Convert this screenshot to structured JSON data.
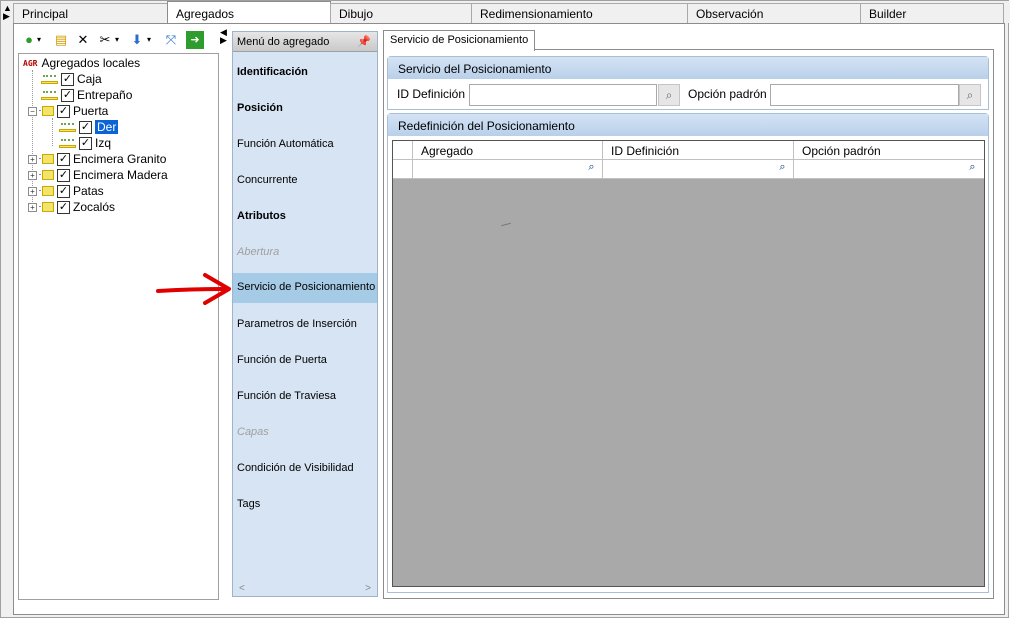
{
  "top_tabs": [
    {
      "label": "Principal",
      "active": false
    },
    {
      "label": "Agregados",
      "active": true
    },
    {
      "label": "Dibujo",
      "active": false
    },
    {
      "label": "Redimensionamiento",
      "active": false
    },
    {
      "label": "Observación",
      "active": false
    },
    {
      "label": "Builder",
      "active": false
    }
  ],
  "toolbar": {
    "icons": [
      "back-icon",
      "new-icon",
      "delete-icon",
      "cut-icon",
      "move-down-icon",
      "connect-icon",
      "export-icon"
    ]
  },
  "tree": {
    "root_badge": "AGR",
    "root_label": "Agregados locales",
    "items": [
      {
        "label": "Caja",
        "checked": true,
        "type": "item"
      },
      {
        "label": "Entrepaño",
        "checked": true,
        "type": "item"
      },
      {
        "label": "Puerta",
        "checked": true,
        "type": "folder",
        "expanded": true
      },
      {
        "label": "Der",
        "checked": true,
        "type": "item",
        "selected": true
      },
      {
        "label": "Izq",
        "checked": true,
        "type": "item"
      },
      {
        "label": "Encimera Granito",
        "checked": true,
        "type": "folder"
      },
      {
        "label": "Encimera Madera",
        "checked": true,
        "type": "folder"
      },
      {
        "label": "Patas",
        "checked": true,
        "type": "folder"
      },
      {
        "label": "Zocalós",
        "checked": true,
        "type": "folder"
      }
    ]
  },
  "menu": {
    "title": "Menú do agregado",
    "items": [
      {
        "label": "Identificación",
        "style": "bold"
      },
      {
        "label": "Posición",
        "style": "bold"
      },
      {
        "label": "Función Automática",
        "style": "normal"
      },
      {
        "label": "Concurrente",
        "style": "normal"
      },
      {
        "label": "Atributos",
        "style": "bold"
      },
      {
        "label": "Abertura",
        "style": "disabled"
      },
      {
        "label": "Servicio de Posicionamiento",
        "style": "active"
      },
      {
        "label": "Parametros de Inserción",
        "style": "normal"
      },
      {
        "label": "Función de Puerta",
        "style": "normal"
      },
      {
        "label": "Función de Traviesa",
        "style": "normal"
      },
      {
        "label": "Capas",
        "style": "disabled"
      },
      {
        "label": "Condición de Visibilidad",
        "style": "normal"
      },
      {
        "label": "Tags",
        "style": "normal"
      }
    ],
    "scroll_left": "<",
    "scroll_right": ">"
  },
  "detail": {
    "tab_label": "Servicio de Posicionamiento",
    "group1": {
      "title": "Servicio del Posicionamiento",
      "id_label": "ID Definición",
      "id_value": "",
      "option_label": "Opción padrón",
      "option_value": ""
    },
    "group2": {
      "title": "Redefinición del Posicionamiento",
      "columns": [
        "Agregado",
        "ID Definición",
        "Opción padrón"
      ]
    }
  },
  "colors": {
    "menu_bg": "#d6e4f3",
    "menu_active": "#a6cbe6",
    "group_header": "#c5d9ef",
    "arrow": "#e00000",
    "grid_bg": "#a9a9a9",
    "selection": "#0a64d8"
  }
}
